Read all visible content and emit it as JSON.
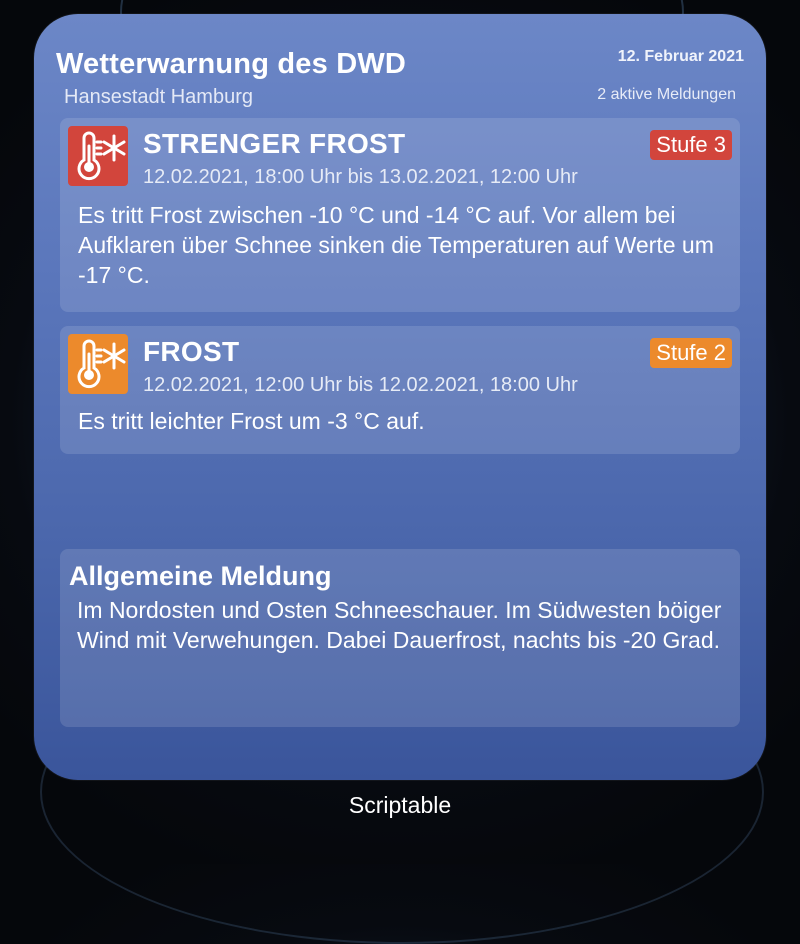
{
  "widget": {
    "title": "Wetterwarnung des DWD",
    "date": "12. Februar 2021",
    "location": "Hansestadt Hamburg",
    "active_count": "2 aktive Meldungen"
  },
  "warnings": [
    {
      "icon": "thermometer-frost-icon",
      "title": "STRENGER FROST",
      "time": "12.02.2021, 18:00 Uhr bis 13.02.2021, 12:00 Uhr",
      "level": "Stufe 3",
      "level_color": "#d2453c",
      "text": "Es tritt Frost zwischen -10 °C und -14 °C auf. Vor allem bei Aufklaren über Schnee sinken die Temperaturen auf Werte um -17 °C."
    },
    {
      "icon": "thermometer-frost-icon",
      "title": "FROST",
      "time": "12.02.2021, 12:00 Uhr bis 12.02.2021, 18:00 Uhr",
      "level": "Stufe 2",
      "level_color": "#ec8a2c",
      "text": "Es tritt leichter Frost um -3 °C auf."
    }
  ],
  "general": {
    "title": "Allgemeine Meldung",
    "text": "Im Nordosten und Osten Schneeschauer. Im Südwesten böiger Wind mit Verwehungen. Dabei Dauerfrost, nachts bis -20 Grad."
  },
  "app_label": "Scriptable"
}
